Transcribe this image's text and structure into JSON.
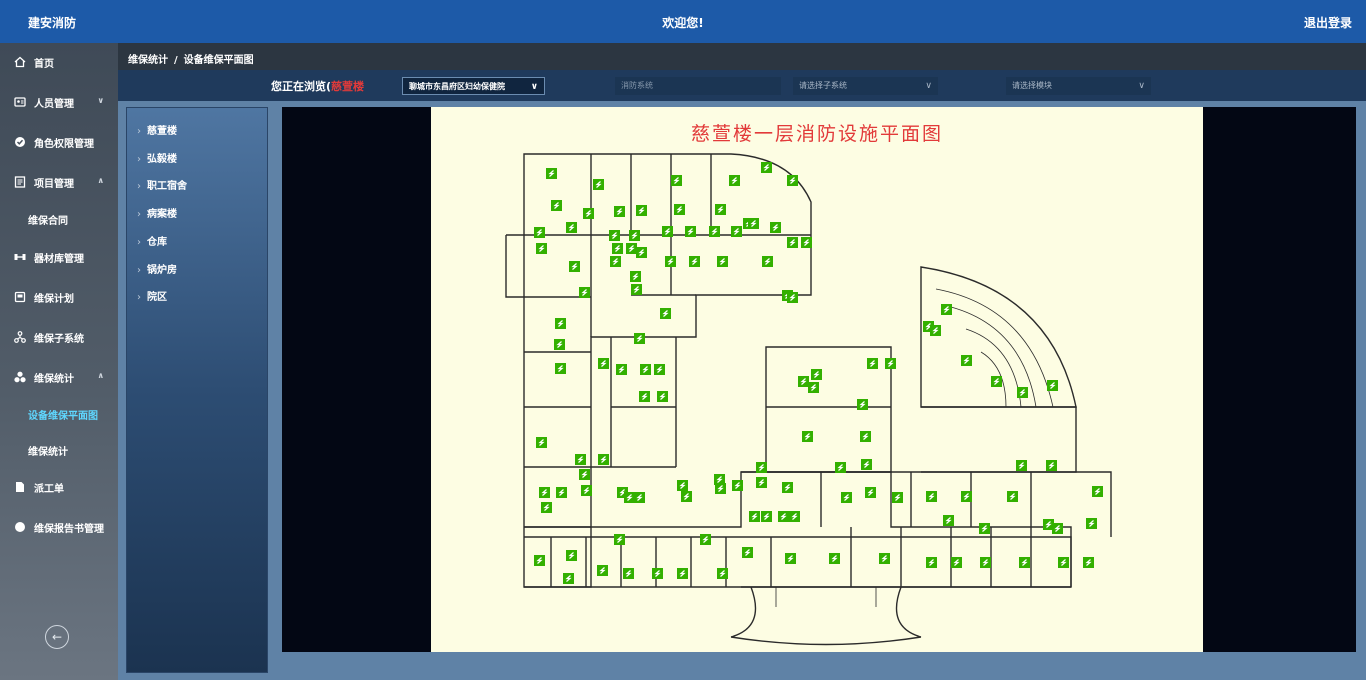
{
  "header": {
    "brand": "建安消防",
    "welcome": "欢迎您!",
    "logout": "退出登录"
  },
  "sidebar": {
    "items": [
      {
        "label": "首页",
        "icon": "home-icon"
      },
      {
        "label": "人员管理",
        "icon": "user-card-icon"
      },
      {
        "label": "角色权限管理",
        "icon": "shield-check-icon"
      },
      {
        "label": "项目管理",
        "icon": "document-icon"
      },
      {
        "label": "维保合同",
        "icon": ""
      },
      {
        "label": "器材库管理",
        "icon": "equipment-icon"
      },
      {
        "label": "维保计划",
        "icon": "calendar-icon"
      },
      {
        "label": "维保子系统",
        "icon": "network-icon"
      },
      {
        "label": "维保统计",
        "icon": "stats-icon"
      },
      {
        "label": "设备维保平面图",
        "icon": ""
      },
      {
        "label": "维保统计",
        "icon": ""
      },
      {
        "label": "派工单",
        "icon": "file-icon"
      },
      {
        "label": "维保报告书管理",
        "icon": "circle-icon"
      }
    ],
    "collapse_icon": "arrow-left-circle-icon"
  },
  "breadcrumb": {
    "parent": "维保统计",
    "separator": "/",
    "current": "设备维保平面图"
  },
  "filter": {
    "browsing_prefix": "您正在浏览(",
    "browsing_building": "慈萱楼",
    "hospital": "聊城市东昌府区妇幼保健院",
    "system_placeholder": "消防系统",
    "subsystem_placeholder": "请选择子系统",
    "module_placeholder": "请选择模块"
  },
  "buildings": [
    "慈萱楼",
    "弘毅楼",
    "职工宿舍",
    "病案楼",
    "仓库",
    "锅炉房",
    "院区"
  ],
  "plan": {
    "title": "慈萱楼一层消防设施平面图",
    "marker_color": "#33b000",
    "wall_color": "#2b2b2b"
  }
}
